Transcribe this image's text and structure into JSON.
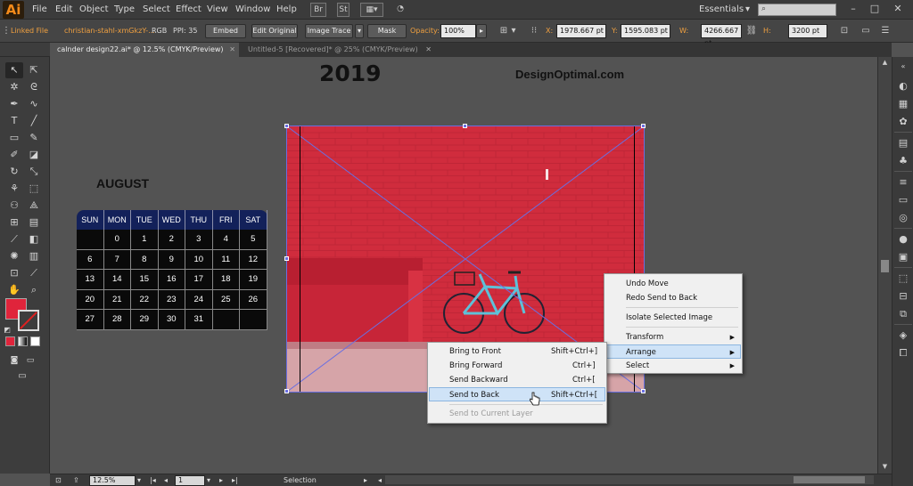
{
  "app": {
    "logo": "Ai",
    "menus": [
      "File",
      "Edit",
      "Object",
      "Type",
      "Select",
      "Effect",
      "View",
      "Window",
      "Help"
    ],
    "menubar_icons": [
      "Br",
      "St"
    ],
    "workspace": "Essentials",
    "search": {
      "placeholder": ""
    }
  },
  "controlbar": {
    "linked_file": "Linked File",
    "file_name": "christian-stahl-xmGkzY-...",
    "color_mode": "RGB",
    "ppi": "PPI: 35",
    "embed": "Embed",
    "edit_original": "Edit Original",
    "image_trace": "Image Trace",
    "mask": "Mask",
    "opacity_label": "Opacity:",
    "opacity_value": "100%",
    "x_label": "X:",
    "x_value": "1978.667 pt",
    "y_label": "Y:",
    "y_value": "1595.083 pt",
    "w_label": "W:",
    "w_value": "4266.667 pt",
    "h_label": "H:",
    "h_value": "3200 pt"
  },
  "tabs": [
    {
      "label": "calnder design22.ai* @ 12.5% (CMYK/Preview)",
      "active": true
    },
    {
      "label": "Untitled-5 [Recovered]* @ 25% (CMYK/Preview)",
      "active": false
    }
  ],
  "canvas": {
    "year": "2019",
    "site": "DesignOptimal.com",
    "month": "AUGUST",
    "weekdays": [
      "SUN",
      "MON",
      "TUE",
      "WED",
      "THU",
      "FRI",
      "SAT"
    ],
    "weeks": [
      [
        "",
        "0",
        "1",
        "2",
        "3",
        "4",
        "5"
      ],
      [
        "6",
        "7",
        "8",
        "9",
        "10",
        "11",
        "12"
      ],
      [
        "13",
        "14",
        "15",
        "16",
        "17",
        "18",
        "19"
      ],
      [
        "20",
        "21",
        "22",
        "23",
        "24",
        "25",
        "26"
      ],
      [
        "27",
        "28",
        "29",
        "30",
        "31",
        "",
        ""
      ]
    ]
  },
  "context_menu": {
    "items": [
      {
        "label": "Undo Move"
      },
      {
        "label": "Redo Send to Back"
      },
      {
        "label": "Isolate Selected Image"
      },
      {
        "label": "Transform",
        "submenu": true
      },
      {
        "label": "Arrange",
        "submenu": true,
        "highlighted": true
      },
      {
        "label": "Select",
        "submenu": true
      }
    ]
  },
  "arrange_submenu": {
    "items": [
      {
        "label": "Bring to Front",
        "shortcut": "Shift+Ctrl+]"
      },
      {
        "label": "Bring Forward",
        "shortcut": "Ctrl+]"
      },
      {
        "label": "Send Backward",
        "shortcut": "Ctrl+["
      },
      {
        "label": "Send to Back",
        "shortcut": "Shift+Ctrl+[",
        "highlighted": true
      },
      {
        "label": "Send to Current Layer",
        "disabled": true
      }
    ]
  },
  "statusbar": {
    "zoom": "12.5%",
    "artboard": "1",
    "tool": "Selection"
  },
  "colors": {
    "accent": "#f48a1a",
    "fill_swatch": "#e0243b",
    "selection": "#6a6fe0",
    "calendar_header": "#13215a"
  }
}
